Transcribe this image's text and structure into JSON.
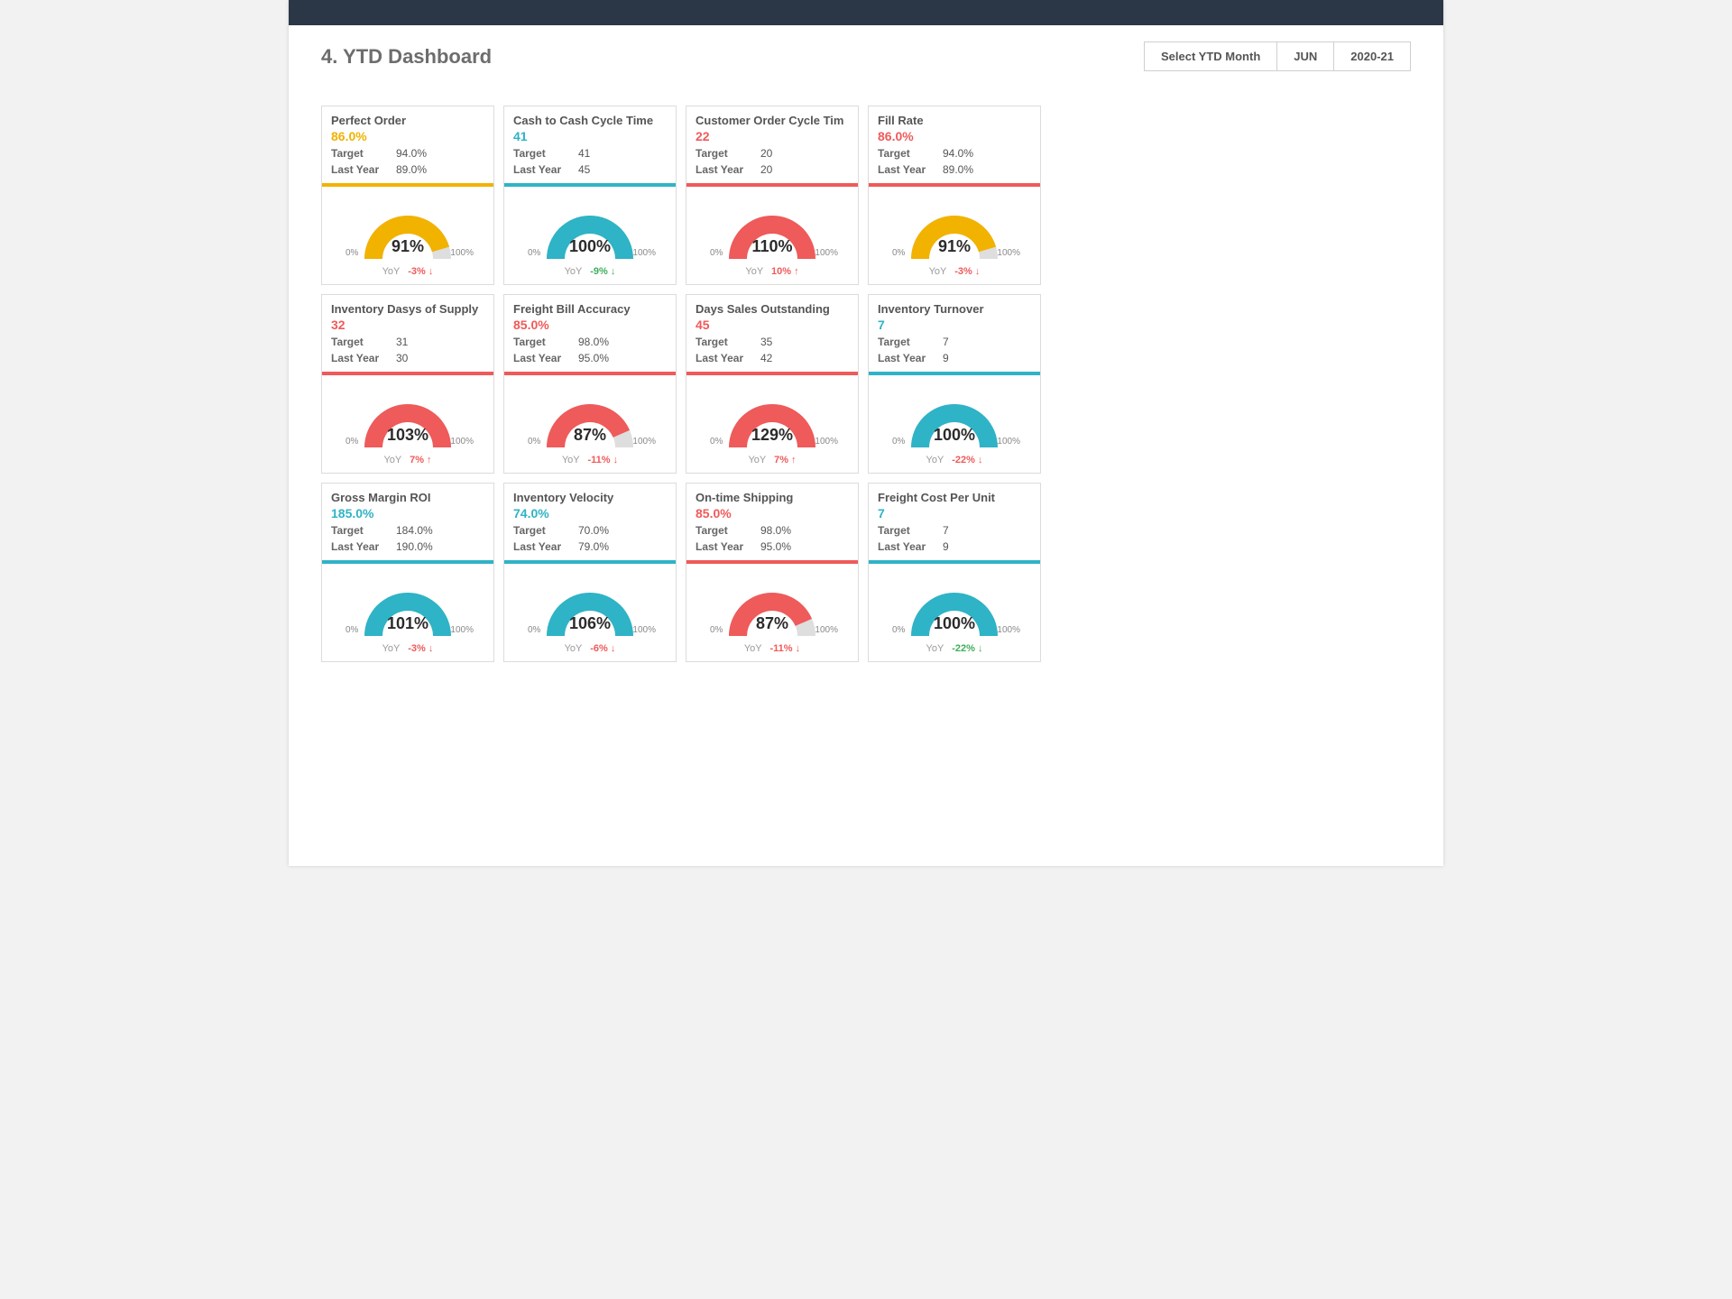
{
  "header": {
    "title": "4. YTD Dashboard",
    "selector_label": "Select YTD Month",
    "month": "JUN",
    "year": "2020-21"
  },
  "colors": {
    "yellow": "#f2b200",
    "teal": "#2fb3c6",
    "red": "#ef5a5a",
    "grey": "#dedede",
    "green": "#3fae5a"
  },
  "labels": {
    "target": "Target",
    "last_year": "Last Year",
    "yoy": "YoY",
    "pct0": "0%",
    "pct100": "100%"
  },
  "chart_data": [
    {
      "id": "perfect-order",
      "title": "Perfect Order",
      "value": "86.0%",
      "accent": "yellow",
      "target": "94.0%",
      "last_year": "89.0%",
      "gauge_pct": 91,
      "gauge_label": "91%",
      "gauge_color": "yellow",
      "yoy": "-3%",
      "yoy_dir": "down",
      "yoy_color": "red"
    },
    {
      "id": "cash-cycle",
      "title": "Cash to Cash Cycle Time",
      "value": "41",
      "accent": "teal",
      "target": "41",
      "last_year": "45",
      "gauge_pct": 100,
      "gauge_label": "100%",
      "gauge_color": "teal",
      "yoy": "-9%",
      "yoy_dir": "down",
      "yoy_color": "green"
    },
    {
      "id": "customer-order-cycle",
      "title": "Customer Order Cycle Tim",
      "value": "22",
      "accent": "red",
      "target": "20",
      "last_year": "20",
      "gauge_pct": 110,
      "gauge_label": "110%",
      "gauge_color": "red",
      "yoy": "10%",
      "yoy_dir": "up",
      "yoy_color": "red"
    },
    {
      "id": "fill-rate",
      "title": "Fill Rate",
      "value": "86.0%",
      "accent": "red",
      "target": "94.0%",
      "last_year": "89.0%",
      "gauge_pct": 91,
      "gauge_label": "91%",
      "gauge_color": "yellow",
      "yoy": "-3%",
      "yoy_dir": "down",
      "yoy_color": "red"
    },
    {
      "id": "inventory-days-supply",
      "title": "Inventory Dasys of Supply",
      "value": "32",
      "accent": "red",
      "target": "31",
      "last_year": "30",
      "gauge_pct": 103,
      "gauge_label": "103%",
      "gauge_color": "red",
      "yoy": "7%",
      "yoy_dir": "up",
      "yoy_color": "red"
    },
    {
      "id": "freight-bill-accuracy",
      "title": "Freight Bill Accuracy",
      "value": "85.0%",
      "accent": "red",
      "target": "98.0%",
      "last_year": "95.0%",
      "gauge_pct": 87,
      "gauge_label": "87%",
      "gauge_color": "red",
      "yoy": "-11%",
      "yoy_dir": "down",
      "yoy_color": "red"
    },
    {
      "id": "days-sales-outstanding",
      "title": "Days Sales Outstanding",
      "value": "45",
      "accent": "red",
      "target": "35",
      "last_year": "42",
      "gauge_pct": 129,
      "gauge_label": "129%",
      "gauge_color": "red",
      "yoy": "7%",
      "yoy_dir": "up",
      "yoy_color": "red"
    },
    {
      "id": "inventory-turnover",
      "title": "Inventory Turnover",
      "value": "7",
      "accent": "teal",
      "target": "7",
      "last_year": "9",
      "gauge_pct": 100,
      "gauge_label": "100%",
      "gauge_color": "teal",
      "yoy": "-22%",
      "yoy_dir": "down",
      "yoy_color": "red"
    },
    {
      "id": "gross-margin-roi",
      "title": "Gross Margin ROI",
      "value": "185.0%",
      "accent": "teal",
      "target": "184.0%",
      "last_year": "190.0%",
      "gauge_pct": 101,
      "gauge_label": "101%",
      "gauge_color": "teal",
      "yoy": "-3%",
      "yoy_dir": "down",
      "yoy_color": "red"
    },
    {
      "id": "inventory-velocity",
      "title": "Inventory Velocity",
      "value": "74.0%",
      "accent": "teal",
      "target": "70.0%",
      "last_year": "79.0%",
      "gauge_pct": 106,
      "gauge_label": "106%",
      "gauge_color": "teal",
      "yoy": "-6%",
      "yoy_dir": "down",
      "yoy_color": "red"
    },
    {
      "id": "on-time-shipping",
      "title": "On-time Shipping",
      "value": "85.0%",
      "accent": "red",
      "target": "98.0%",
      "last_year": "95.0%",
      "gauge_pct": 87,
      "gauge_label": "87%",
      "gauge_color": "red",
      "yoy": "-11%",
      "yoy_dir": "down",
      "yoy_color": "red"
    },
    {
      "id": "freight-cost-per-unit",
      "title": "Freight Cost Per Unit",
      "value": "7",
      "accent": "teal",
      "target": "7",
      "last_year": "9",
      "gauge_pct": 100,
      "gauge_label": "100%",
      "gauge_color": "teal",
      "yoy": "-22%",
      "yoy_dir": "down",
      "yoy_color": "green"
    }
  ]
}
